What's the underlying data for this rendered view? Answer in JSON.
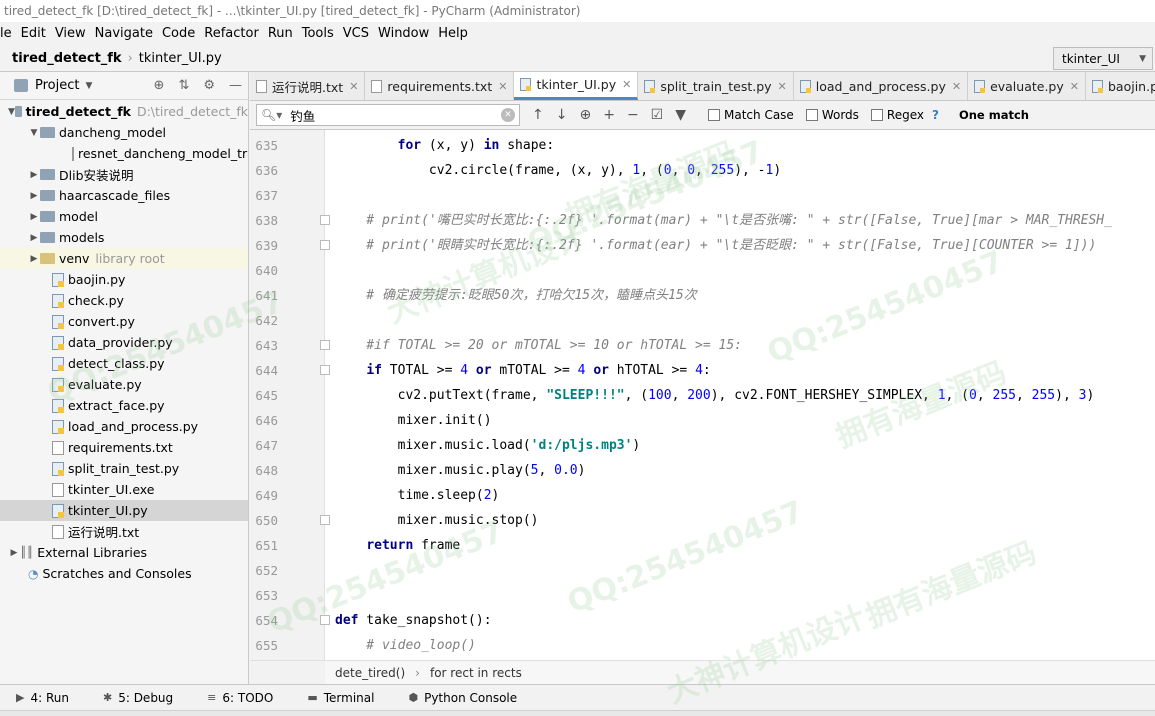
{
  "window": {
    "title": "tired_detect_fk [D:\\tired_detect_fk] - ...\\tkinter_UI.py [tired_detect_fk] - PyCharm (Administrator)"
  },
  "menu": [
    "le",
    "Edit",
    "View",
    "Navigate",
    "Code",
    "Refactor",
    "Run",
    "Tools",
    "VCS",
    "Window",
    "Help"
  ],
  "nav": {
    "project": "tired_detect_fk",
    "file": "tkinter_UI.py",
    "run_config": "tkinter_UI"
  },
  "project_panel": {
    "title": "Project",
    "tree": [
      {
        "label": "tired_detect_fk",
        "extra": "D:\\tired_detect_fk",
        "type": "folder",
        "bold": true
      },
      {
        "label": "dancheng_model",
        "type": "folder"
      },
      {
        "label": "resnet_dancheng_model_tra",
        "type": "file"
      },
      {
        "label": "Dlib安装说明",
        "type": "folder"
      },
      {
        "label": "haarcascade_files",
        "type": "folder"
      },
      {
        "label": "model",
        "type": "folder"
      },
      {
        "label": "models",
        "type": "folder"
      },
      {
        "label": "venv",
        "extra": "library root",
        "type": "folder"
      },
      {
        "label": "baojin.py",
        "type": "py"
      },
      {
        "label": "check.py",
        "type": "py"
      },
      {
        "label": "convert.py",
        "type": "py"
      },
      {
        "label": "data_provider.py",
        "type": "py"
      },
      {
        "label": "detect_class.py",
        "type": "py"
      },
      {
        "label": "evaluate.py",
        "type": "py"
      },
      {
        "label": "extract_face.py",
        "type": "py"
      },
      {
        "label": "load_and_process.py",
        "type": "py"
      },
      {
        "label": "requirements.txt",
        "type": "txt"
      },
      {
        "label": "split_train_test.py",
        "type": "py"
      },
      {
        "label": "tkinter_UI.exe",
        "type": "file"
      },
      {
        "label": "tkinter_UI.py",
        "type": "py"
      },
      {
        "label": "运行说明.txt",
        "type": "txt"
      },
      {
        "label": "External Libraries",
        "type": "lib"
      },
      {
        "label": "Scratches and Consoles",
        "type": "scratch"
      }
    ]
  },
  "tabs": [
    "运行说明.txt",
    "requirements.txt",
    "tkinter_UI.py",
    "split_train_test.py",
    "load_and_process.py",
    "evaluate.py",
    "baojin.py"
  ],
  "find": {
    "query": "钓鱼",
    "match_case": "Match Case",
    "words": "Words",
    "regex": "Regex",
    "help": "?",
    "status": "One match"
  },
  "code_lines": [
    {
      "n": "635",
      "text": "        for (x, y) in shape:"
    },
    {
      "n": "636",
      "text": "            cv2.circle(frame, (x, y), 1, (0, 0, 255), -1)"
    },
    {
      "n": "637",
      "text": ""
    },
    {
      "n": "638",
      "text": "    # print('嘴巴实时长宽比:{:.2f} '.format(mar) + \"\\t是否张嘴: \" + str([False, True][mar > MAR_THRESH_"
    },
    {
      "n": "639",
      "text": "    # print('眼睛实时长宽比:{:.2f} '.format(ear) + \"\\t是否眨眼: \" + str([False, True][COUNTER >= 1]))"
    },
    {
      "n": "640",
      "text": ""
    },
    {
      "n": "641",
      "text": "    # 确定疲劳提示:眨眼50次，打哈欠15次，瞌睡点头15次"
    },
    {
      "n": "642",
      "text": ""
    },
    {
      "n": "643",
      "text": "    #if TOTAL >= 20 or mTOTAL >= 10 or hTOTAL >= 15:"
    },
    {
      "n": "644",
      "text": "    if TOTAL >= 4 or mTOTAL >= 4 or hTOTAL >= 4:"
    },
    {
      "n": "645",
      "text": "        cv2.putText(frame, \"SLEEP!!!\", (100, 200), cv2.FONT_HERSHEY_SIMPLEX, 1, (0, 255, 255), 3)"
    },
    {
      "n": "646",
      "text": "        mixer.init()"
    },
    {
      "n": "647",
      "text": "        mixer.music.load('d:/pljs.mp3')"
    },
    {
      "n": "648",
      "text": "        mixer.music.play(5, 0.0)"
    },
    {
      "n": "649",
      "text": "        time.sleep(2)"
    },
    {
      "n": "650",
      "text": "        mixer.music.stop()"
    },
    {
      "n": "651",
      "text": "    return frame"
    },
    {
      "n": "652",
      "text": ""
    },
    {
      "n": "653",
      "text": ""
    },
    {
      "n": "654",
      "text": "def take_snapshot():"
    },
    {
      "n": "655",
      "text": "    # video_loop()"
    }
  ],
  "breadcrumb": [
    "dete_tired()",
    "for rect in rects"
  ],
  "tool_windows": [
    "4: Run",
    "5: Debug",
    "6: TODO",
    "Terminal",
    "Python Console"
  ],
  "watermarks": [
    "QQ:254540457",
    "大神计算机设计",
    "拥有海量源码"
  ]
}
